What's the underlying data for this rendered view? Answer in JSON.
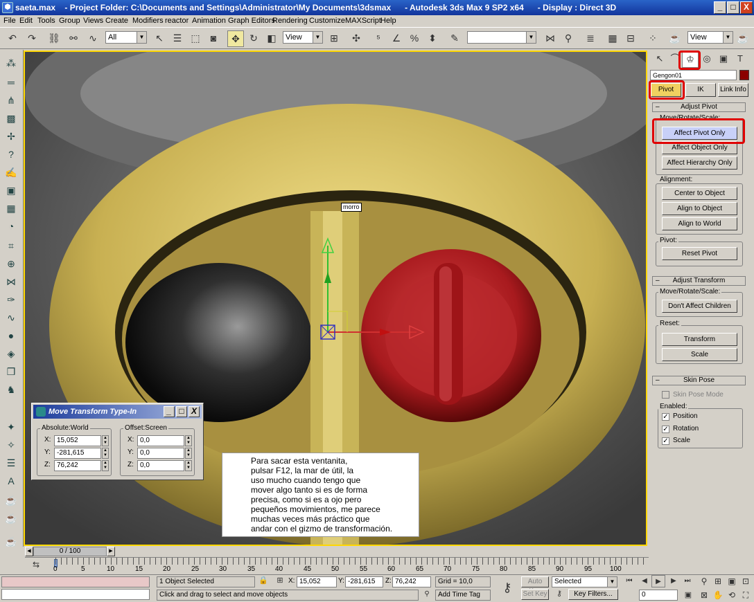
{
  "window": {
    "title": "saeta.max    - Project Folder: C:\\Documents and Settings\\Administrator\\My Documents\\3dsmax      - Autodesk 3ds Max 9 SP2 x64      - Display : Direct 3D",
    "buttons": [
      "_",
      "□",
      "X"
    ]
  },
  "menu": [
    "File",
    "Edit",
    "Tools",
    "Group",
    "Views",
    "Create",
    "Modifiers",
    "reactor",
    "Animation",
    "Graph Editors",
    "Rendering",
    "Customize",
    "MAXScript",
    "Help"
  ],
  "toolbar": {
    "selection_filter": "All",
    "ref_coord": "View",
    "named_selection": "",
    "viewport_combo": "View"
  },
  "viewport": {
    "object_label": "morro",
    "colors": {
      "border": "#ffd700",
      "yellow": "#d8c060",
      "red": "#b01c20"
    }
  },
  "command_panel": {
    "object_name": "Gengon01",
    "object_color": "#8b0000",
    "tabs": [
      "Pivot",
      "IK",
      "Link Info"
    ],
    "adjust_pivot": {
      "title": "Adjust Pivot",
      "move_rotate_scale_label": "Move/Rotate/Scale:",
      "buttons": [
        "Affect Pivot Only",
        "Affect Object Only",
        "Affect Hierarchy Only"
      ],
      "alignment_label": "Alignment:",
      "alignment_buttons": [
        "Center to Object",
        "Align to Object",
        "Align to World"
      ],
      "pivot_label": "Pivot:",
      "reset_pivot": "Reset Pivot"
    },
    "adjust_transform": {
      "title": "Adjust Transform",
      "move_rotate_scale_label": "Move/Rotate/Scale:",
      "dont_affect": "Don't Affect Children",
      "reset_label": "Reset:",
      "transform": "Transform",
      "scale": "Scale"
    },
    "skin_pose": {
      "title": "Skin Pose",
      "mode": "Skin Pose Mode",
      "enabled_label": "Enabled:",
      "position": "Position",
      "rotation": "Rotation",
      "scale": "Scale"
    }
  },
  "dialog": {
    "title": "Move Transform Type-In",
    "absolute_label": "Absolute:World",
    "offset_label": "Offset:Screen",
    "abs": {
      "x": "15,052",
      "y": "-281,615",
      "z": "76,242"
    },
    "off": {
      "x": "0,0",
      "y": "0,0",
      "z": "0,0"
    },
    "axis": {
      "x": "X:",
      "y": "Y:",
      "z": "Z:"
    }
  },
  "note": {
    "lines": [
      "Para sacar esta ventanita,",
      "pulsar F12, la mar de útil, la",
      "uso mucho cuando tengo que",
      "mover algo tanto si es de forma",
      "precisa, como si es a ojo pero",
      "pequeños movimientos, me parece",
      "muchas veces más práctico que",
      "andar con el gizmo de transformación."
    ]
  },
  "timeline": {
    "slider": "0 / 100",
    "ticks": [
      "0",
      "5",
      "10",
      "15",
      "20",
      "25",
      "30",
      "35",
      "40",
      "45",
      "50",
      "55",
      "60",
      "65",
      "70",
      "75",
      "80",
      "85",
      "90",
      "95",
      "100"
    ]
  },
  "status": {
    "selected": "1 Object Selected",
    "prompt": "Click and drag to select and move objects",
    "x": "15,052",
    "y": "-281,615",
    "z": "76,242",
    "x_label": "X:",
    "y_label": "Y:",
    "z_label": "Z:",
    "grid": "Grid = 10,0",
    "add_time_tag": "Add Time Tag",
    "auto_key": "Auto Key",
    "set_key": "Set Key",
    "selected_combo": "Selected",
    "key_filters": "Key Filters...",
    "frame": "0"
  }
}
